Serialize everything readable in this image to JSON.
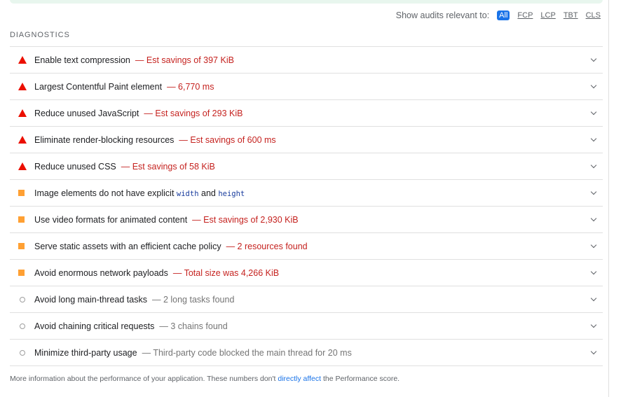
{
  "filter": {
    "label": "Show audits relevant to:",
    "options": [
      "All",
      "FCP",
      "LCP",
      "TBT",
      "CLS"
    ],
    "active": "All"
  },
  "section_title": "DIAGNOSTICS",
  "audits": [
    {
      "severity": "fail",
      "title": "Enable text compression",
      "display": "— Est savings of 397 KiB"
    },
    {
      "severity": "fail",
      "title": "Largest Contentful Paint element",
      "display": "— 6,770 ms"
    },
    {
      "severity": "fail",
      "title": "Reduce unused JavaScript",
      "display": "— Est savings of 293 KiB"
    },
    {
      "severity": "fail",
      "title": "Eliminate render-blocking resources",
      "display": "— Est savings of 600 ms"
    },
    {
      "severity": "fail",
      "title": "Reduce unused CSS",
      "display": "— Est savings of 58 KiB"
    },
    {
      "severity": "average",
      "title_parts": [
        "Image elements do not have explicit ",
        "width",
        " and ",
        "height"
      ],
      "display": ""
    },
    {
      "severity": "average",
      "title": "Use video formats for animated content",
      "display": "— Est savings of 2,930 KiB"
    },
    {
      "severity": "average",
      "title": "Serve static assets with an efficient cache policy",
      "display": "— 2 resources found"
    },
    {
      "severity": "average",
      "title": "Avoid enormous network payloads",
      "display": "— Total size was 4,266 KiB"
    },
    {
      "severity": "info",
      "title": "Avoid long main-thread tasks",
      "display": "— 2 long tasks found"
    },
    {
      "severity": "info",
      "title": "Avoid chaining critical requests",
      "display": "— 3 chains found"
    },
    {
      "severity": "info",
      "title": "Minimize third-party usage",
      "display": "— Third-party code blocked the main thread for 20 ms"
    }
  ],
  "footer": {
    "text_before": "More information about the performance of your application. These numbers don't ",
    "link": "directly affect",
    "text_after": " the Performance score."
  },
  "colors": {
    "fail": "#eb0f00",
    "average": "#ffa033",
    "info": "#9e9e9e",
    "accent": "#1a73e8"
  }
}
